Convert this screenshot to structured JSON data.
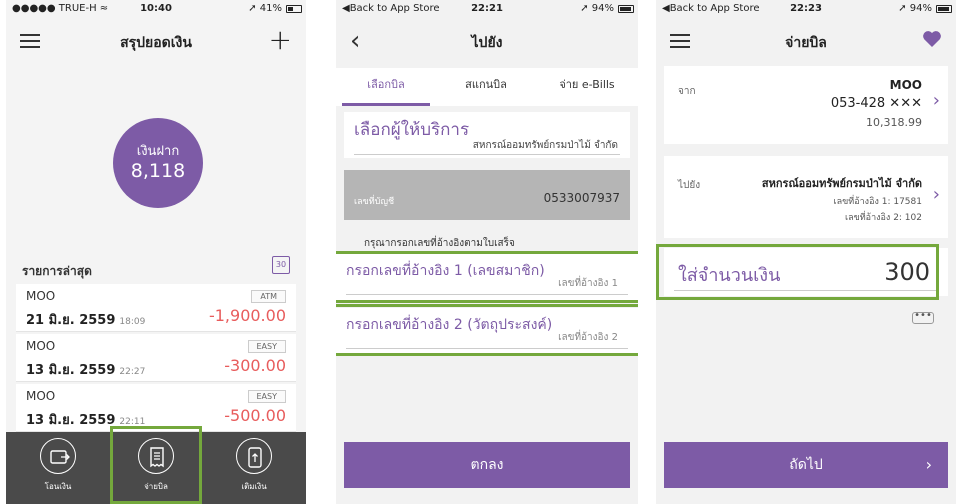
{
  "screen1": {
    "status": {
      "carrier": "●●●●● TRUE-H ≈",
      "time": "10:40",
      "battery": "➚ 41%",
      "battery_level": 0.41
    },
    "title": "สรุปยอดเงิน",
    "balance": {
      "label": "เงินฝาก",
      "value": "8,118"
    },
    "recent_title": "รายการล่าสุด",
    "calendar_day": "30",
    "transactions": [
      {
        "name": "MOO",
        "date": "21 มิ.ย. 2559",
        "time": "18:09",
        "badge": "ATM",
        "amount": "-1,900.00"
      },
      {
        "name": "MOO",
        "date": "13 มิ.ย. 2559",
        "time": "22:27",
        "badge": "EASY",
        "amount": "-300.00"
      },
      {
        "name": "MOO",
        "date": "13 มิ.ย. 2559",
        "time": "22:11",
        "badge": "EASY",
        "amount": "-500.00"
      }
    ],
    "tabbar": [
      {
        "label": "โอนเงิน",
        "icon": "wallet-transfer-icon"
      },
      {
        "label": "จ่ายบิล",
        "icon": "receipt-icon"
      },
      {
        "label": "เติมเงิน",
        "icon": "phone-topup-icon"
      }
    ]
  },
  "screen2": {
    "status": {
      "back": "◀Back to App Store",
      "time": "22:21",
      "battery": "➚ 94%",
      "battery_level": 0.94
    },
    "title": "ไปยัง",
    "tabs": [
      "เลือกบิล",
      "สแกนบิล",
      "จ่าย e-Bills"
    ],
    "provider_title": "เลือกผู้ให้บริการ",
    "provider_value": "สหกรณ์ออมทรัพย์กรมป่าไม้ จำกัด",
    "account_label": "เลขที่บัญชี",
    "account_value": "0533007937",
    "hint": "กรุณากรอกเลขที่อ้างอิงตามใบเสร็จ",
    "ref1_label": "กรอกเลขที่อ้างอิง 1 (เลขสมาชิก)",
    "ref1_placeholder": "เลขที่อ้างอิง 1",
    "ref2_label": "กรอกเลขที่อ้างอิง 2 (วัตถุประสงค์)",
    "ref2_placeholder": "เลขที่อ้างอิง 2",
    "submit": "ตกลง"
  },
  "screen3": {
    "status": {
      "back": "◀Back to App Store",
      "time": "22:23",
      "battery": "➚ 94%",
      "battery_level": 0.94
    },
    "title": "จ่ายบิล",
    "from_label": "จาก",
    "from_name": "MOO",
    "from_account": "053-428 ✕✕✕",
    "from_balance": "10,318.99",
    "to_label": "ไปยัง",
    "to_name": "สหกรณ์ออมทรัพย์กรมป่าไม้ จำกัด",
    "to_ref1": "เลขที่อ้างอิง 1: 17581",
    "to_ref2": "เลขที่อ้างอิง 2: 102",
    "amount_label": "ใส่จำนวนเงิน",
    "amount_value": "300",
    "more": "•••",
    "next": "ถัดไป",
    "next_arrow": "›"
  },
  "colors": {
    "brand": "#7d5ba6",
    "negative": "#e85c5c",
    "highlight": "#74a83c",
    "tabbar": "#4a4a4a"
  }
}
